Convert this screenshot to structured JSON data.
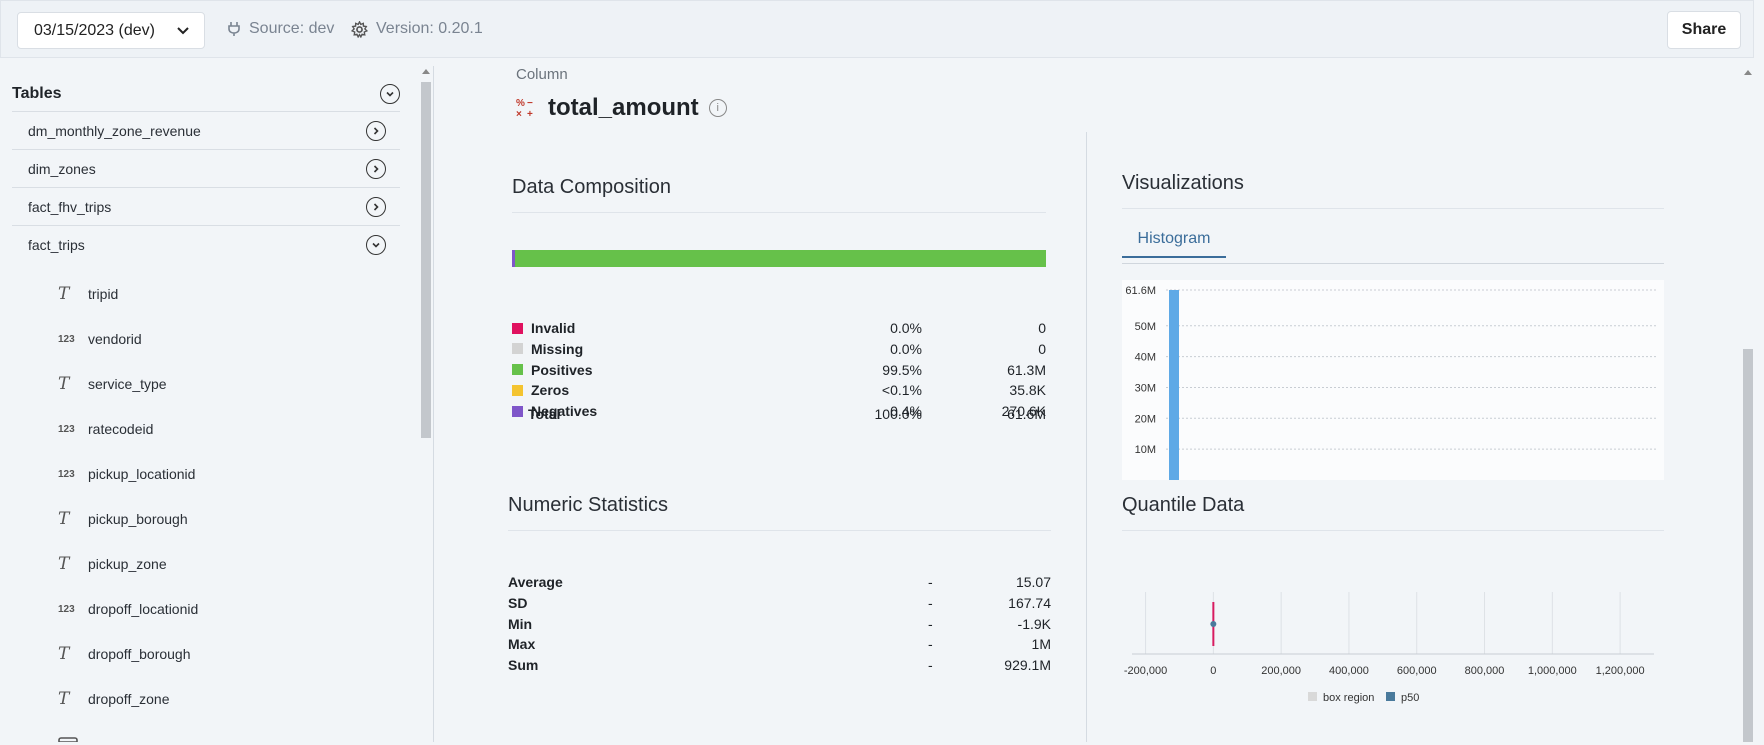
{
  "topbar": {
    "date_select": "03/15/2023 (dev)",
    "source": "Source: dev",
    "version": "Version: 0.20.1",
    "share": "Share"
  },
  "sidebar": {
    "header": "Tables",
    "tables": [
      {
        "name": "dm_monthly_zone_revenue",
        "expanded": false
      },
      {
        "name": "dim_zones",
        "expanded": false
      },
      {
        "name": "fact_fhv_trips",
        "expanded": false
      },
      {
        "name": "fact_trips",
        "expanded": true
      }
    ],
    "columns": [
      {
        "type": "T",
        "name": "tripid"
      },
      {
        "type": "123",
        "name": "vendorid"
      },
      {
        "type": "T",
        "name": "service_type"
      },
      {
        "type": "123",
        "name": "ratecodeid"
      },
      {
        "type": "123",
        "name": "pickup_locationid"
      },
      {
        "type": "T",
        "name": "pickup_borough"
      },
      {
        "type": "T",
        "name": "pickup_zone"
      },
      {
        "type": "123",
        "name": "dropoff_locationid"
      },
      {
        "type": "T",
        "name": "dropoff_borough"
      },
      {
        "type": "T",
        "name": "dropoff_zone"
      }
    ]
  },
  "column": {
    "label": "Column",
    "name": "total_amount",
    "info": "i"
  },
  "composition": {
    "title": "Data Composition",
    "positives_fraction": 0.995,
    "negatives_fraction": 0.004,
    "rows": [
      {
        "label": "Invalid",
        "pct": "0.0%",
        "count": "0",
        "color": "#e0115f"
      },
      {
        "label": "Missing",
        "pct": "0.0%",
        "count": "0",
        "color": "#d3d3d3"
      },
      {
        "label": "Positives",
        "pct": "99.5%",
        "count": "61.3M",
        "color": "#66c14a"
      },
      {
        "label": "Zeros",
        "pct": "<0.1%",
        "count": "35.8K",
        "color": "#f4c430"
      },
      {
        "label": "Negatives",
        "pct": "0.4%",
        "count": "270.6K",
        "color": "#7f56c9"
      }
    ],
    "total": {
      "label": "Total",
      "pct": "100.0%",
      "count": "61.6M"
    }
  },
  "numeric": {
    "title": "Numeric Statistics",
    "rows": [
      {
        "label": "Average",
        "dash": "-",
        "value": "15.07"
      },
      {
        "label": "SD",
        "dash": "-",
        "value": "167.74"
      },
      {
        "label": "Min",
        "dash": "-",
        "value": "-1.9K"
      },
      {
        "label": "Max",
        "dash": "-",
        "value": "1M"
      },
      {
        "label": "Sum",
        "dash": "-",
        "value": "929.1M"
      }
    ]
  },
  "visualizations": {
    "title": "Visualizations",
    "tab": "Histogram"
  },
  "quantile": {
    "title": "Quantile Data"
  },
  "colors": {
    "accent": "#3b6d9a",
    "histogram_bar": "#5ea9e6",
    "quantile_line": "#d81b60",
    "p50": "#4a7a9c",
    "box_region": "#d9d9d9"
  },
  "chart_data": [
    {
      "type": "bar",
      "yticks": [
        "61.6M",
        "50M",
        "40M",
        "30M",
        "20M",
        "10M"
      ],
      "ytick_values": [
        61600000,
        50000000,
        40000000,
        30000000,
        20000000,
        10000000
      ],
      "ylim": [
        0,
        61600000
      ],
      "values": [
        61600000
      ],
      "grid": true
    },
    {
      "type": "scatter",
      "xticks": [
        "-200,000",
        "0",
        "200,000",
        "400,000",
        "600,000",
        "800,000",
        "1,000,000",
        "1,200,000"
      ],
      "xtick_values": [
        -200000,
        0,
        200000,
        400000,
        600000,
        800000,
        1000000,
        1200000
      ],
      "xlim": [
        -240000,
        1300000
      ],
      "p50": 15,
      "legend": [
        "box region",
        "p50"
      ],
      "legend_position": "bottom",
      "grid": true
    }
  ]
}
